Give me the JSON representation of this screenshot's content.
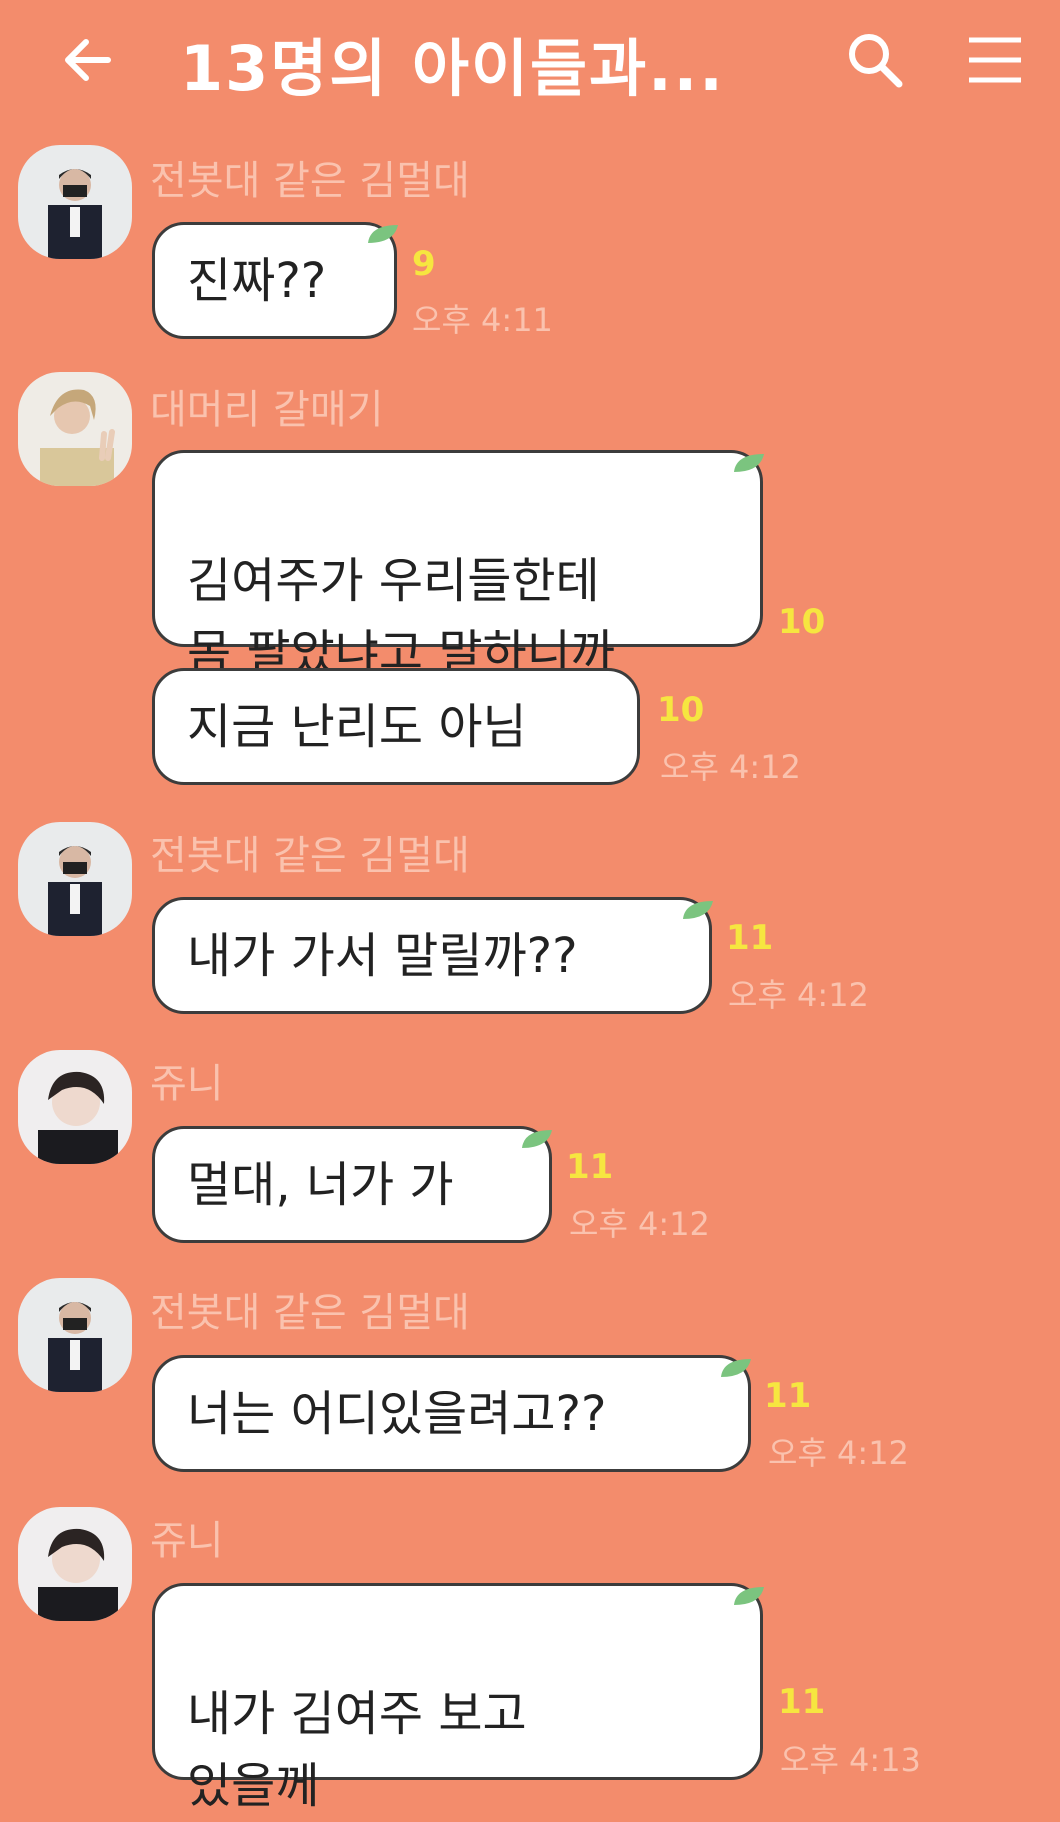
{
  "header": {
    "title": "13명의 아이들과...",
    "back_icon": "arrow-left-icon",
    "search_icon": "search-icon",
    "menu_icon": "hamburger-menu-icon"
  },
  "colors": {
    "background": "#F38C6C",
    "bubble": "#FFFFFF",
    "sender_name": "#FAC2AE",
    "read_count": "#F6E640",
    "leaf": "#7BC47F"
  },
  "messages": [
    {
      "sender": "전봇대 같은 김멀대",
      "text": "진짜??",
      "read": "9",
      "time": "오후 4:11"
    },
    {
      "sender": "대머리 갈매기",
      "text": "김여주가 우리들한테\n몸 팔았냐고 말하니까",
      "read": "10",
      "time": ""
    },
    {
      "sender": "",
      "text": "지금 난리도 아님",
      "read": "10",
      "time": "오후 4:12"
    },
    {
      "sender": "전봇대 같은 김멀대",
      "text": "내가 가서 말릴까??",
      "read": "11",
      "time": "오후 4:12"
    },
    {
      "sender": "쥬니",
      "text": "멀대, 너가 가",
      "read": "11",
      "time": "오후 4:12"
    },
    {
      "sender": "전봇대 같은 김멀대",
      "text": "너는 어디있을려고??",
      "read": "11",
      "time": "오후 4:12"
    },
    {
      "sender": "쥬니",
      "text": "내가 김여주 보고\n있을께",
      "read": "11",
      "time": "오후 4:13"
    }
  ]
}
